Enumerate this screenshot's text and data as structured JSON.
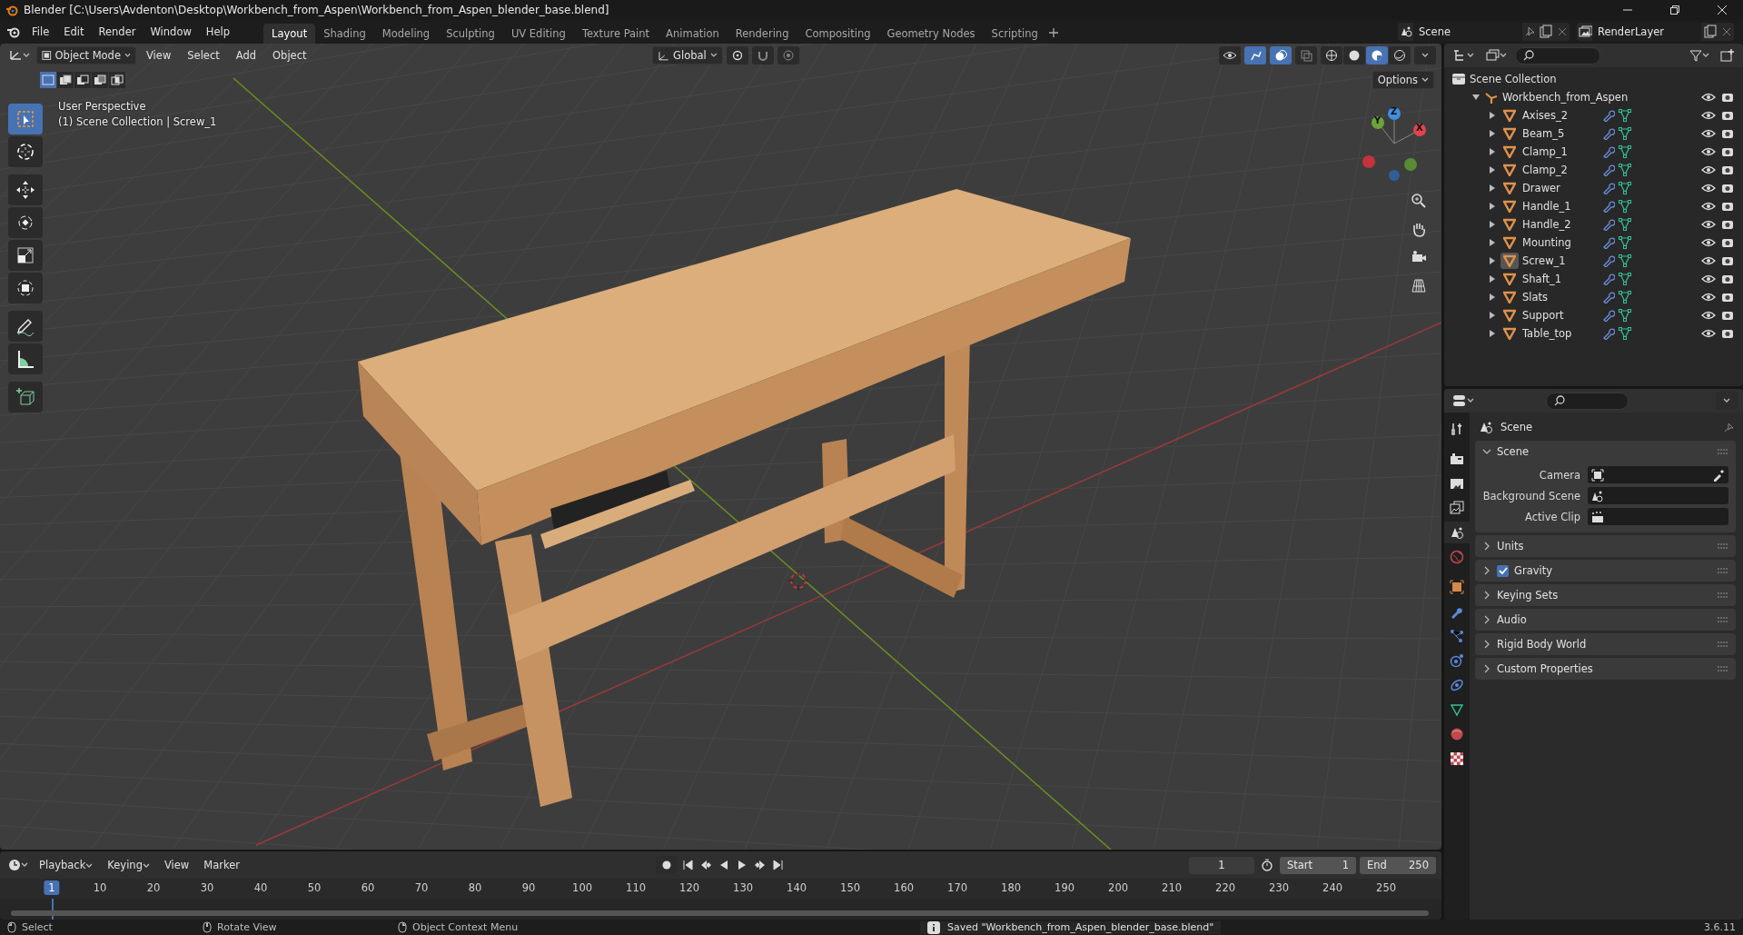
{
  "window": {
    "title": "Blender [C:\\Users\\Avdenton\\Desktop\\Workbench_from_Aspen\\Workbench_from_Aspen_blender_base.blend]"
  },
  "menu": [
    "File",
    "Edit",
    "Render",
    "Window",
    "Help"
  ],
  "workspaces": [
    {
      "label": "Layout",
      "selected": true
    },
    {
      "label": "Shading",
      "selected": false
    },
    {
      "label": "Modeling",
      "selected": false
    },
    {
      "label": "Sculpting",
      "selected": false
    },
    {
      "label": "UV Editing",
      "selected": false
    },
    {
      "label": "Texture Paint",
      "selected": false
    },
    {
      "label": "Animation",
      "selected": false
    },
    {
      "label": "Rendering",
      "selected": false
    },
    {
      "label": "Compositing",
      "selected": false
    },
    {
      "label": "Geometry Nodes",
      "selected": false
    },
    {
      "label": "Scripting",
      "selected": false
    }
  ],
  "scene_selector": {
    "value": "Scene"
  },
  "view_layer_selector": {
    "value": "RenderLayer"
  },
  "viewport": {
    "mode": "Object Mode",
    "menus": [
      "View",
      "Select",
      "Add",
      "Object"
    ],
    "orientation": "Global",
    "options": "Options",
    "toggles": [
      {
        "kind": "gizmos",
        "on": true
      },
      {
        "kind": "overlays",
        "on": true
      },
      {
        "kind": "xray",
        "on": false
      }
    ],
    "shading_modes": [
      {
        "kind": "wireframe",
        "selected": false
      },
      {
        "kind": "solid",
        "selected": false
      },
      {
        "kind": "material",
        "selected": true
      },
      {
        "kind": "rendered",
        "selected": false
      }
    ],
    "selection_modes": [
      {
        "kind": "set",
        "selected": true
      },
      {
        "kind": "extend",
        "selected": false
      },
      {
        "kind": "subtract",
        "selected": false
      },
      {
        "kind": "invert",
        "selected": false
      },
      {
        "kind": "intersect",
        "selected": false
      }
    ],
    "info_lines": [
      "User Perspective",
      "(1) Scene Collection | Screw_1"
    ],
    "tools": [
      {
        "kind": "select",
        "selected": true
      },
      {
        "kind": "cursor",
        "selected": false
      },
      {
        "kind": "move",
        "selected": false
      },
      {
        "kind": "rotate",
        "selected": false
      },
      {
        "kind": "scale",
        "selected": false
      },
      {
        "kind": "transform",
        "selected": false
      },
      {
        "kind": "annotate",
        "selected": false
      },
      {
        "kind": "measure",
        "selected": false
      },
      {
        "kind": "add_cube",
        "selected": false
      }
    ],
    "gizmo_axes": [
      "X",
      "Y",
      "Z"
    ]
  },
  "outliner": {
    "root": "Scene Collection",
    "collection": {
      "name": "Workbench_from_Aspen",
      "expanded": true,
      "children": [
        {
          "name": "Axises_2",
          "active": false,
          "visible": true,
          "renderable": true
        },
        {
          "name": "Beam_5",
          "active": false,
          "visible": true,
          "renderable": true
        },
        {
          "name": "Clamp_1",
          "active": false,
          "visible": true,
          "renderable": true
        },
        {
          "name": "Clamp_2",
          "active": false,
          "visible": true,
          "renderable": true
        },
        {
          "name": "Drawer",
          "active": false,
          "visible": true,
          "renderable": true
        },
        {
          "name": "Handle_1",
          "active": false,
          "visible": true,
          "renderable": true
        },
        {
          "name": "Handle_2",
          "active": false,
          "visible": true,
          "renderable": true
        },
        {
          "name": "Mounting",
          "active": false,
          "visible": true,
          "renderable": true
        },
        {
          "name": "Screw_1",
          "active": true,
          "visible": true,
          "renderable": true
        },
        {
          "name": "Shaft_1",
          "active": false,
          "visible": true,
          "renderable": true
        },
        {
          "name": "Slats",
          "active": false,
          "visible": true,
          "renderable": true
        },
        {
          "name": "Support",
          "active": false,
          "visible": true,
          "renderable": true
        },
        {
          "name": "Table_top",
          "active": false,
          "visible": true,
          "renderable": true
        }
      ]
    }
  },
  "properties": {
    "tabs": [
      {
        "kind": "tool",
        "selected": false
      },
      {
        "kind": "render",
        "selected": false
      },
      {
        "kind": "output",
        "selected": false
      },
      {
        "kind": "view_layer",
        "selected": false
      },
      {
        "kind": "scene",
        "selected": true
      },
      {
        "kind": "world",
        "selected": false
      },
      {
        "kind": "object",
        "selected": false
      },
      {
        "kind": "modifiers",
        "selected": false
      },
      {
        "kind": "particles",
        "selected": false
      },
      {
        "kind": "physics",
        "selected": false
      },
      {
        "kind": "constraints",
        "selected": false
      },
      {
        "kind": "data",
        "selected": false
      },
      {
        "kind": "material",
        "selected": false
      },
      {
        "kind": "texture",
        "selected": false
      }
    ],
    "context": "Scene",
    "panels": [
      {
        "title": "Scene",
        "expanded": true,
        "fields": [
          {
            "label": "Camera",
            "kind": "camera"
          },
          {
            "label": "Background Scene",
            "kind": "scene"
          },
          {
            "label": "Active Clip",
            "kind": "clip"
          }
        ]
      },
      {
        "title": "Units",
        "expanded": false
      },
      {
        "title": "Gravity",
        "expanded": false,
        "checked": true
      },
      {
        "title": "Keying Sets",
        "expanded": false
      },
      {
        "title": "Audio",
        "expanded": false
      },
      {
        "title": "Rigid Body World",
        "expanded": false
      },
      {
        "title": "Custom Properties",
        "expanded": false
      }
    ]
  },
  "timeline": {
    "menus": [
      "Playback",
      "Keying",
      "View",
      "Marker"
    ],
    "current_frame": "1",
    "start_label": "Start",
    "start": "1",
    "end_label": "End",
    "end": "250",
    "playhead": "1",
    "ruler_labels": [
      "10",
      "20",
      "30",
      "40",
      "50",
      "60",
      "70",
      "80",
      "90",
      "100",
      "110",
      "120",
      "130",
      "140",
      "150",
      "160",
      "170",
      "180",
      "190",
      "200",
      "210",
      "220",
      "230",
      "240",
      "250"
    ]
  },
  "status_bar": {
    "hints": [
      "Select",
      "Rotate View",
      "Object Context Menu"
    ],
    "message": "Saved \"Workbench_from_Aspen_blender_base.blend\"",
    "version": "3.6.11"
  }
}
